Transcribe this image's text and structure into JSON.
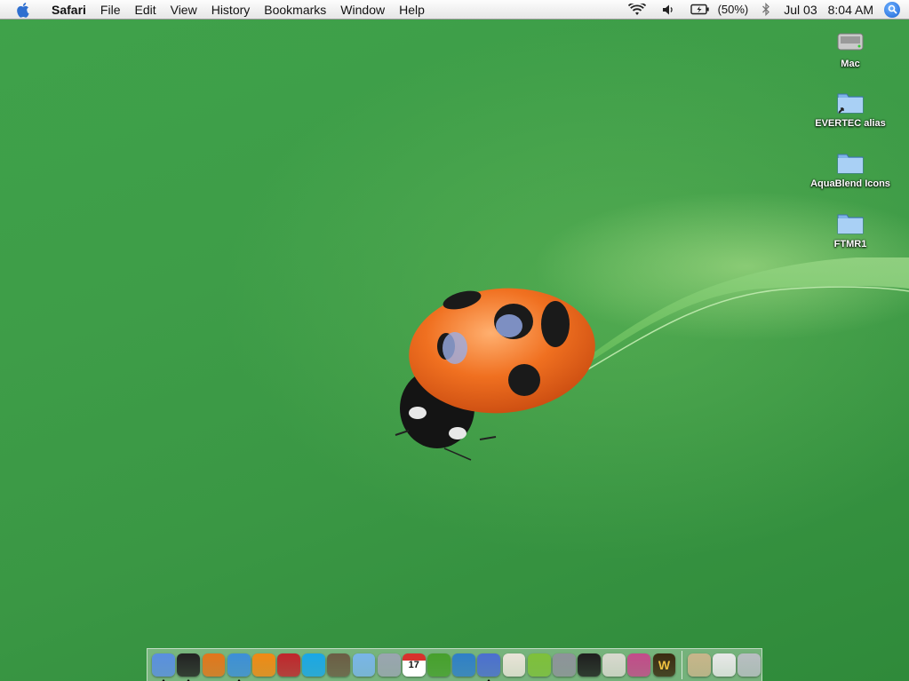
{
  "menubar": {
    "app_name": "Safari",
    "menus": [
      "File",
      "Edit",
      "View",
      "History",
      "Bookmarks",
      "Window",
      "Help"
    ],
    "status": {
      "battery": "(50%)",
      "date": "Jul 03",
      "time": "8:04 AM"
    }
  },
  "desktop_icons": [
    {
      "label": "Mac",
      "icon": "hard-drive-icon"
    },
    {
      "label": "EVERTEC alias",
      "icon": "folder-alias-icon"
    },
    {
      "label": "AquaBlend Icons",
      "icon": "folder-icon"
    },
    {
      "label": "FTMR1",
      "icon": "folder-icon"
    }
  ],
  "dock": {
    "apps": [
      {
        "icon": "finder-icon",
        "color": "#5a8fe0",
        "running": true
      },
      {
        "icon": "dashboard-icon",
        "color": "#222222",
        "running": true
      },
      {
        "icon": "firefox-icon",
        "color": "#e2761b",
        "running": false
      },
      {
        "icon": "safari-icon",
        "color": "#3d8fd8",
        "running": true
      },
      {
        "icon": "vlc-icon",
        "color": "#f08a14",
        "running": false
      },
      {
        "icon": "chess-icon",
        "color": "#c0262c",
        "running": false
      },
      {
        "icon": "skype-icon",
        "color": "#1aa7e6",
        "running": false
      },
      {
        "icon": "iphoto-icon",
        "color": "#6b5d44",
        "running": false
      },
      {
        "icon": "itunes-icon",
        "color": "#79b5e8",
        "running": false
      },
      {
        "icon": "preview-icon",
        "color": "#9aa5b0",
        "running": false
      },
      {
        "icon": "ical-icon",
        "color": "#d8322c",
        "running": false,
        "glyph": "17"
      },
      {
        "icon": "dreamweaver-icon",
        "color": "#46a02c",
        "running": false
      },
      {
        "icon": "office-icon",
        "color": "#2f7fc8",
        "running": false
      },
      {
        "icon": "ichat-icon",
        "color": "#4b6fd0",
        "running": true
      },
      {
        "icon": "mail-icon",
        "color": "#e9e4d8",
        "running": false
      },
      {
        "icon": "target-icon",
        "color": "#7ec03a",
        "running": false
      },
      {
        "icon": "system-prefs-icon",
        "color": "#8e939a",
        "running": false
      },
      {
        "icon": "terminal-icon",
        "color": "#1e1e1e",
        "running": false
      },
      {
        "icon": "textedit-icon",
        "color": "#d9d9cf",
        "running": false
      },
      {
        "icon": "pencil-icon",
        "color": "#c34b8a",
        "running": false
      },
      {
        "icon": "warcraft-icon",
        "color": "#3a2a10",
        "running": false,
        "glyph": "W"
      }
    ],
    "docs": [
      {
        "icon": "applications-icon",
        "color": "#c8b58a"
      },
      {
        "icon": "documents-icon",
        "color": "#e8e8e8"
      },
      {
        "icon": "trash-icon",
        "color": "#b8bec2"
      }
    ]
  }
}
